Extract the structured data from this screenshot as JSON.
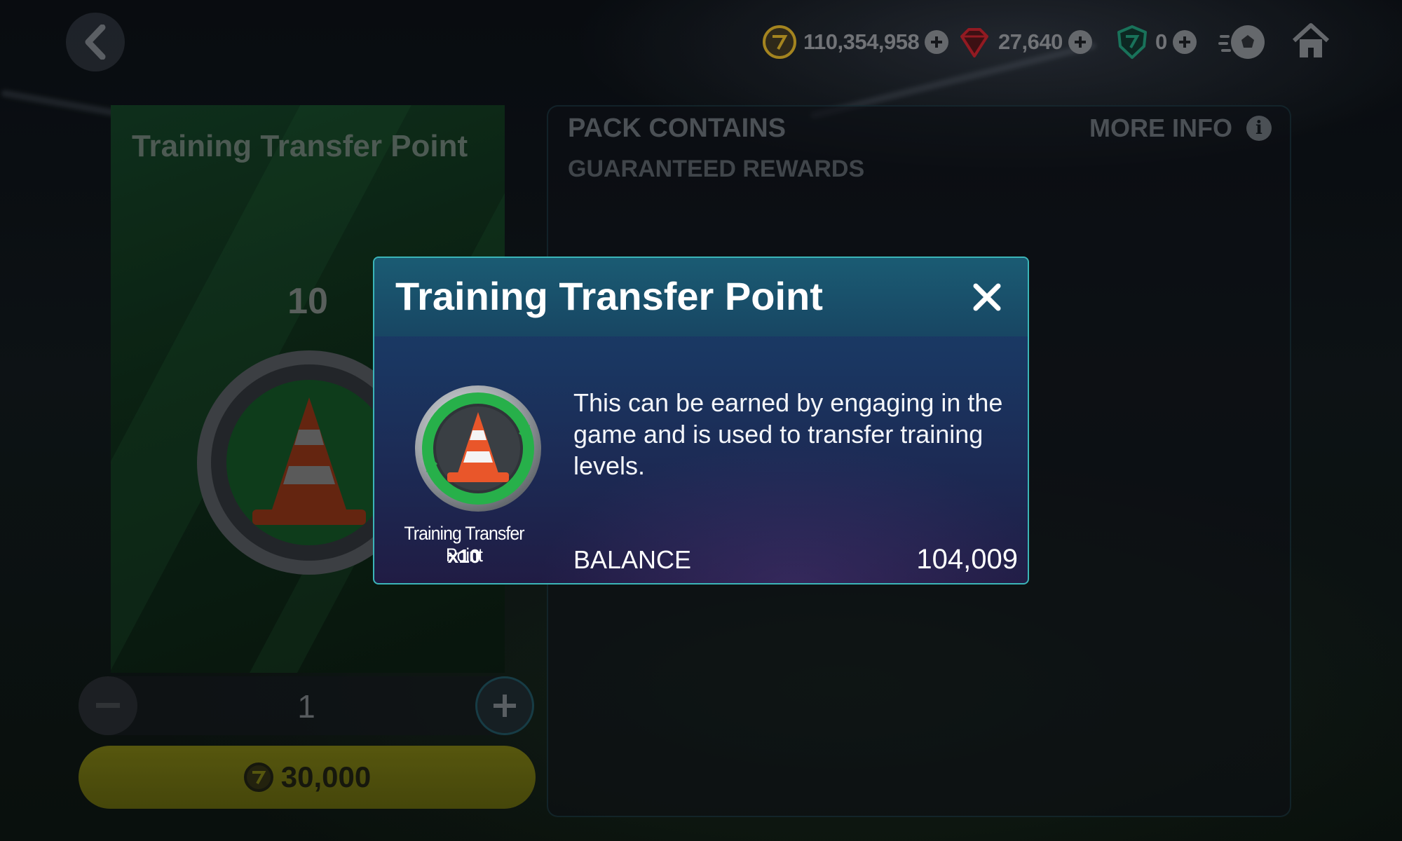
{
  "top_bar": {
    "currencies": [
      {
        "name": "coins",
        "value": "110,354,958",
        "color": "#c9a227"
      },
      {
        "name": "gems",
        "value": "27,640",
        "color": "#b3202a"
      },
      {
        "name": "points",
        "value": "0",
        "color": "#1f8c6e"
      }
    ]
  },
  "pack": {
    "title": "Training Transfer Point",
    "quantity": "10",
    "stepper_value": "1",
    "price": "30,000"
  },
  "contents_panel": {
    "title": "PACK CONTAINS",
    "more_info_label": "MORE INFO",
    "subtitle": "GUARANTEED REWARDS"
  },
  "modal": {
    "title": "Training Transfer Point",
    "item_name": "Training Transfer Point",
    "item_count": "x10",
    "description": "This can be earned by engaging in the game and is used to transfer training levels.",
    "balance_label": "BALANCE",
    "balance_value": "104,009"
  },
  "colors": {
    "accent": "#3bb5b8",
    "buy_button": "#55560d",
    "token_green": "#27b04a",
    "cone_orange": "#e9562a"
  }
}
